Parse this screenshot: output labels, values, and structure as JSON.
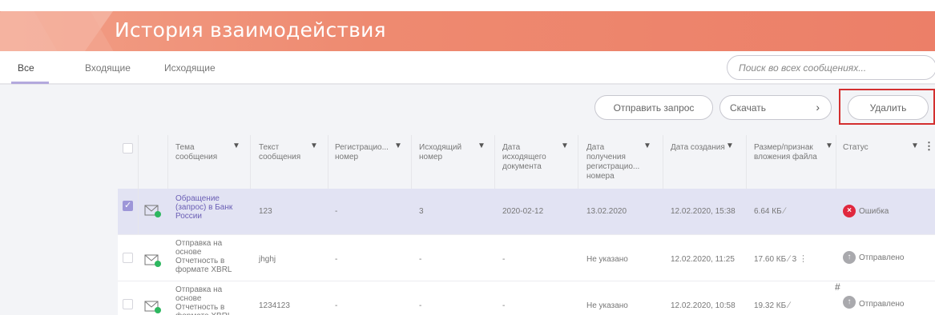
{
  "header": {
    "title": "История взаимодействия"
  },
  "tabs": [
    {
      "label": "Все",
      "active": true
    },
    {
      "label": "Входящие",
      "active": false
    },
    {
      "label": "Исходящие",
      "active": false
    }
  ],
  "search": {
    "placeholder": "Поиск во всех сообщениях..."
  },
  "toolbar": {
    "send_label": "Отправить запрос",
    "download_label": "Скачать",
    "delete_label": "Удалить"
  },
  "table": {
    "columns": [
      "Тема сообщения",
      "Текст сообщения",
      "Регистрацио... номер",
      "Исходящий номер",
      "Дата исходящего документа",
      "Дата получения регистрацио... номера",
      "Дата создания",
      "Размер/признак вложения файла",
      "Статус"
    ],
    "rows": [
      {
        "checked": true,
        "subject": "Обращение (запрос) в Банк России",
        "text": "123",
        "reg_number": "-",
        "out_number": "3",
        "out_date": "2020-02-12",
        "reg_date": "13.02.2020",
        "created": "12.02.2020, 15:38",
        "size": "6.64 КБ",
        "extra": "",
        "status": "Ошибка",
        "status_type": "error"
      },
      {
        "checked": false,
        "subject": "Отправка на основе Отчетность в формате XBRL",
        "text": "jhghj",
        "reg_number": "-",
        "out_number": "-",
        "out_date": "-",
        "reg_date": "Не указано",
        "created": "12.02.2020, 11:25",
        "size": "17.60 КБ",
        "extra": "3",
        "status": "Отправлено",
        "status_type": "sent"
      },
      {
        "checked": false,
        "subject": "Отправка на основе Отчетность в формате XBRL",
        "text": "1234123",
        "reg_number": "-",
        "out_number": "-",
        "out_date": "-",
        "reg_date": "Не указано",
        "created": "12.02.2020, 10:58",
        "size": "19.32 КБ",
        "extra": "",
        "status": "Отправлено",
        "status_type": "sent"
      }
    ]
  },
  "colors": {
    "accent": "#ee8a70",
    "selection": "#e2e3f3",
    "error": "#e0283e",
    "highlight_frame": "#d32f2f"
  }
}
